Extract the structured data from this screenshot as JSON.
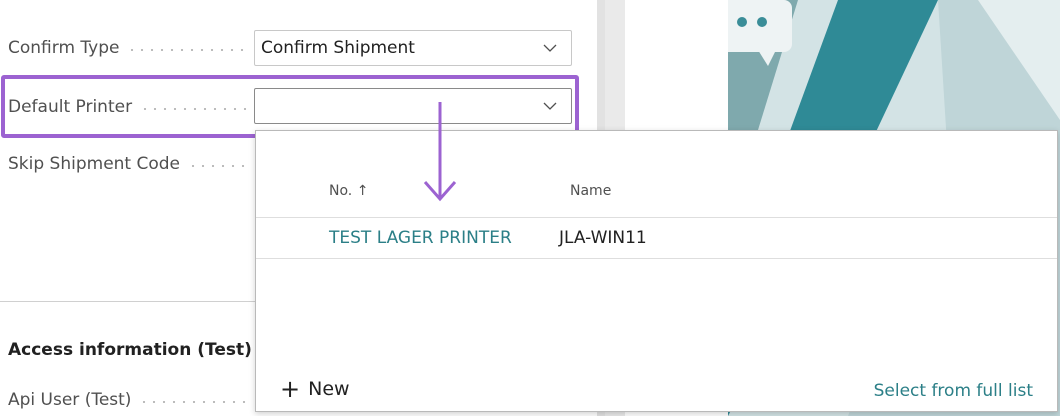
{
  "fields": {
    "confirm_type": {
      "label": "Confirm Type",
      "value": "Confirm Shipment"
    },
    "default_printer": {
      "label": "Default Printer",
      "value": ""
    },
    "skip_shipment_code": {
      "label": "Skip Shipment Code"
    },
    "api_user": {
      "label": "Api User (Test)"
    }
  },
  "section": {
    "title": "Access information (Test)"
  },
  "lookup": {
    "columns": {
      "no": "No. ↑",
      "name": "Name"
    },
    "rows": [
      {
        "no": "TEST LAGER PRINTER",
        "name": "JLA-WIN11"
      }
    ],
    "new_label": "New",
    "full_list_label": "Select from full list"
  },
  "colors": {
    "highlight": "#9c63d1",
    "link": "#2b7f87",
    "arrow": "#9c63d1"
  },
  "icons": [
    "chevron-down-icon",
    "plus-icon",
    "down-arrow-annotation-icon",
    "chat-bubble-icon"
  ]
}
